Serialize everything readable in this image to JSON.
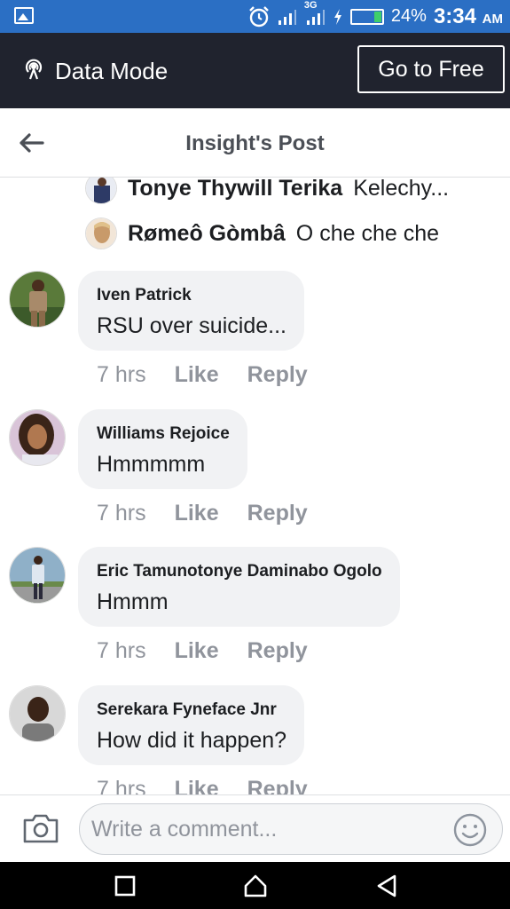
{
  "status_bar": {
    "network_type": "3G",
    "battery_percent": "24%",
    "battery_level": 0.24,
    "time": "3:34",
    "time_suffix": "AM"
  },
  "data_bar": {
    "mode_label": "Data Mode",
    "go_free_label": "Go to Free"
  },
  "header": {
    "title": "Insight's Post"
  },
  "replies": [
    {
      "name": "Tonye Thywill Terika",
      "text": "Kelechy..."
    },
    {
      "name": "Rømeô Gòmbâ",
      "text": "O che che che"
    }
  ],
  "comments": [
    {
      "name": "Iven Patrick",
      "text": "RSU over suicide...",
      "time": "7 hrs",
      "like": "Like",
      "reply": "Reply"
    },
    {
      "name": "Williams Rejoice",
      "text": "Hmmmmm",
      "time": "7 hrs",
      "like": "Like",
      "reply": "Reply"
    },
    {
      "name": "Eric Tamunotonye Daminabo Ogolo",
      "text": "Hmmm",
      "time": "7 hrs",
      "like": "Like",
      "reply": "Reply"
    },
    {
      "name": "Serekara Fyneface Jnr",
      "text": "How did it happen?",
      "time": "7 hrs",
      "like": "Like",
      "reply": "Reply"
    }
  ],
  "composer": {
    "placeholder": "Write a comment..."
  },
  "colors": {
    "status_bar": "#2b6fc4",
    "data_bar": "#20232e",
    "bubble": "#f1f2f4",
    "muted_text": "#90949c"
  }
}
